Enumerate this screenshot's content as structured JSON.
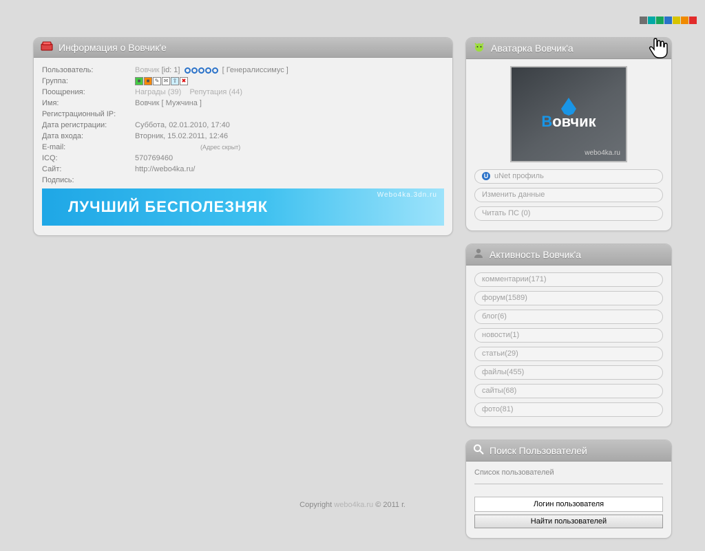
{
  "theme_colors": [
    "#6f6f6f",
    "#00a9a5",
    "#17a65a",
    "#2a72c9",
    "#d8c400",
    "#f08a00",
    "#e22b2b"
  ],
  "info": {
    "title": "Информация о Вовчик'е",
    "rows": {
      "user_k": "Пользователь:",
      "user_name": "Вовчик",
      "user_id": "[id: 1]",
      "user_rank": "[ Генералиссимус ]",
      "group_k": "Группа:",
      "rewards_k": "Поощрения:",
      "rewards_awards": "Награды (39)",
      "rewards_rep": "Репутация (44)",
      "name_k": "Имя:",
      "name_v": "Вовчик [ Мужчина ]",
      "regip_k": "Регистрационный IP:",
      "regdate_k": "Дата регистрации:",
      "regdate_v": "Суббота, 02.01.2010, 17:40",
      "login_k": "Дата входа:",
      "login_v": "Вторник, 15.02.2011, 12:46",
      "email_k": "E-mail:",
      "email_v": "(Адрес скрыт)",
      "icq_k": "ICQ:",
      "icq_v": "570769460",
      "site_k": "Сайт:",
      "site_v": "http://webo4ka.ru/",
      "sig_k": "Подпись:"
    },
    "banner_main": "ЛУЧШИЙ БЕСПОЛЕЗНЯК",
    "banner_sub": "Webo4ka.3dn.ru"
  },
  "avatar_panel": {
    "title": "Аватарка Вовчик'а",
    "name": "Вовчик",
    "url": "webo4ka.ru",
    "links": {
      "unet": "uNet профиль",
      "edit": "Изменить данные",
      "pm": "Читать ПС (0)"
    }
  },
  "activity": {
    "title": "Активность Вовчик'а",
    "items": [
      "комментарии(171)",
      "форум(1589)",
      "блог(6)",
      "новости(1)",
      "статьи(29)",
      "файлы(455)",
      "сайты(68)",
      "фото(81)"
    ]
  },
  "search": {
    "title": "Поиск Пользователей",
    "list_link": "Список пользователей",
    "placeholder": "Логин пользователя",
    "button": "Найти пользователей"
  },
  "footer": {
    "prefix": "Copyright ",
    "brand": "webo4ka.ru",
    "suffix": " © 2011 г."
  }
}
